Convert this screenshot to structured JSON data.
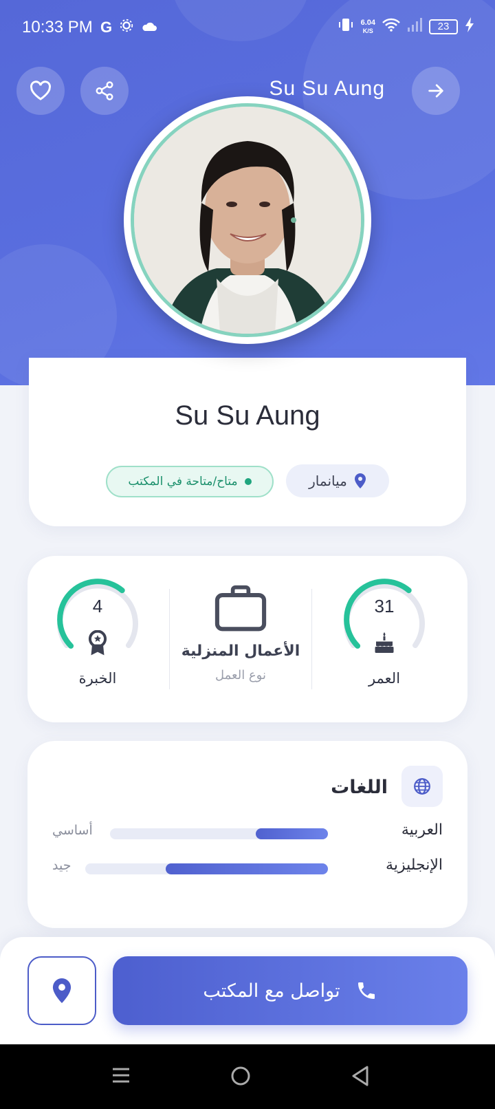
{
  "status_bar": {
    "time": "10:33 PM",
    "speed_value": "6.04",
    "speed_unit": "K/S",
    "battery": "23",
    "left_icons": [
      "google-icon",
      "settings-icon",
      "cloud-icon"
    ],
    "right_icons": [
      "vibrate-icon",
      "wifi-icon",
      "signal-icon",
      "battery-icon",
      "charging-icon"
    ]
  },
  "header": {
    "name": "Su Su Aung",
    "buttons": [
      "favorite-icon",
      "share-icon",
      "forward-arrow-icon"
    ]
  },
  "profile": {
    "name": "Su Su Aung",
    "location": "ميانمار",
    "availability": "متاح/متاحة في المكتب"
  },
  "stats": {
    "age": {
      "value": "31",
      "label": "العمر",
      "progress": 0.65
    },
    "job": {
      "value": "الأعمال المنزلية",
      "label": "نوع العمل"
    },
    "experience": {
      "value": "4",
      "label": "الخبرة",
      "progress": 0.65
    }
  },
  "languages": {
    "title": "اللغات",
    "items": [
      {
        "name": "العربية",
        "level": "أساسي",
        "progress": 0.33
      },
      {
        "name": "الإنجليزية",
        "level": "جيد",
        "progress": 0.67
      }
    ]
  },
  "actions": {
    "contact_label": "تواصل مع المكتب"
  },
  "colors": {
    "primary": "#5568d8",
    "accent_green": "#26c29a",
    "text_dark": "#2d3142"
  }
}
